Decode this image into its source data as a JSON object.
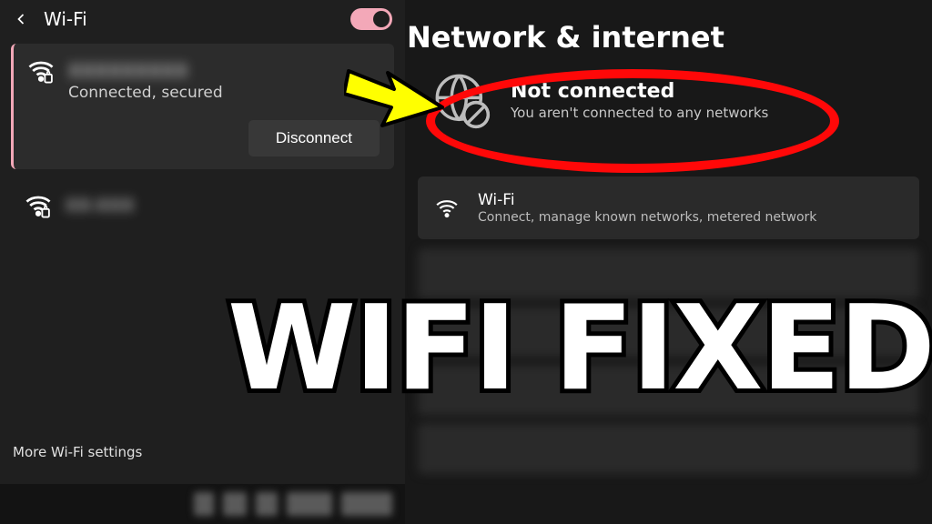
{
  "left": {
    "title": "Wi-Fi",
    "connected": {
      "ssid": "XXXXXXXXX",
      "status": "Connected, secured",
      "disconnect_label": "Disconnect"
    },
    "other_ssid": "XX-XXX",
    "more_settings": "More Wi-Fi settings"
  },
  "right": {
    "heading": "Network & internet",
    "not_connected": {
      "title": "Not connected",
      "subtitle": "You aren't connected to any networks"
    },
    "wifi_row": {
      "title": "Wi-Fi",
      "subtitle": "Connect, manage known networks, metered network"
    }
  },
  "overlay_text": "WIFI FIXED"
}
